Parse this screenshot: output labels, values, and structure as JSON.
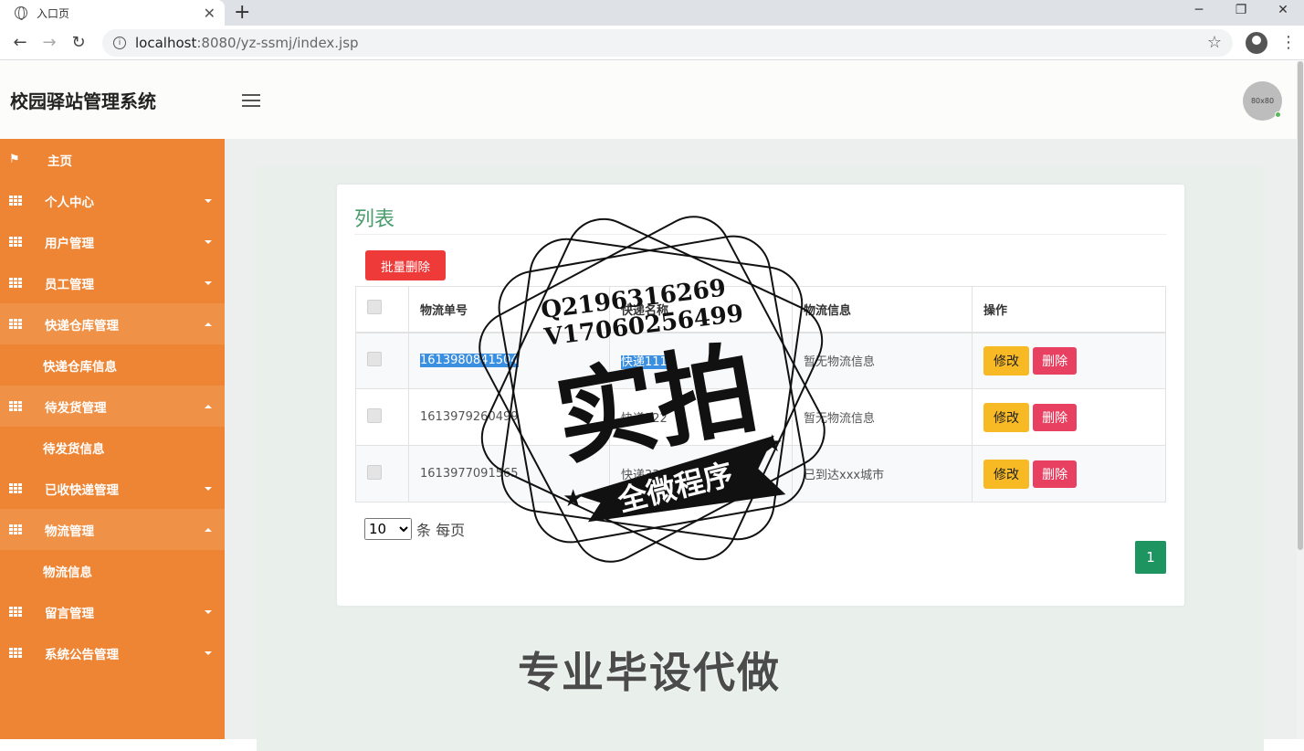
{
  "browser": {
    "tab_title": "入口页",
    "url_host": "localhost",
    "url_path": ":8080/yz-ssmj/index.jsp"
  },
  "app": {
    "brand": "校园驿站管理系统",
    "avatar_text": "80x80"
  },
  "sidebar": {
    "items": [
      {
        "label": "主页",
        "icon": "flag-icon",
        "caret": "none"
      },
      {
        "label": "个人中心",
        "icon": "grid-icon",
        "caret": "down"
      },
      {
        "label": "用户管理",
        "icon": "grid-icon",
        "caret": "down"
      },
      {
        "label": "员工管理",
        "icon": "grid-icon",
        "caret": "down"
      },
      {
        "label": "快递仓库管理",
        "icon": "grid-icon",
        "caret": "up",
        "sub": "快递仓库信息"
      },
      {
        "label": "待发货管理",
        "icon": "grid-icon",
        "caret": "up",
        "sub": "待发货信息"
      },
      {
        "label": "已收快递管理",
        "icon": "grid-icon",
        "caret": "down"
      },
      {
        "label": "物流管理",
        "icon": "grid-icon",
        "caret": "up",
        "sub": "物流信息"
      },
      {
        "label": "留言管理",
        "icon": "grid-icon",
        "caret": "down"
      },
      {
        "label": "系统公告管理",
        "icon": "grid-icon",
        "caret": "down"
      }
    ]
  },
  "card": {
    "title": "列表",
    "batch_delete": "批量删除",
    "columns": [
      "物流单号",
      "快递名称",
      "物流信息",
      "操作"
    ],
    "rows": [
      {
        "no": "1613980841504",
        "name": "快递111",
        "info": "暂无物流信息"
      },
      {
        "no": "1613979260499",
        "name": "快递222",
        "info": "暂无物流信息"
      },
      {
        "no": "1613977091565",
        "name": "快递333",
        "info": "已到达xxx城市"
      }
    ],
    "edit_label": "修改",
    "delete_label": "删除",
    "page_size": "10",
    "page_size_suffix": "条 每页",
    "current_page": "1"
  },
  "watermark": {
    "line1": "Q2196316269",
    "line2": "V17060256499",
    "big": "实拍",
    "ribbon": "全微程序",
    "bottom": "专业毕设代做"
  }
}
